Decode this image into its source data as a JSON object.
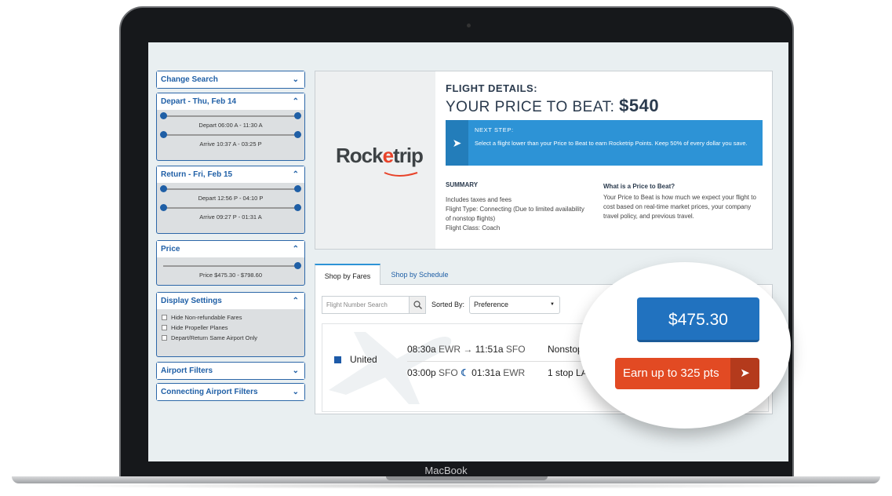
{
  "device": {
    "label": "MacBook"
  },
  "sidebar": {
    "change_search": "Change Search",
    "depart": {
      "title": "Depart - Thu, Feb 14",
      "depart_range": "Depart   06:00 A - 11:30 A",
      "arrive_range": "Arrive   10:37 A - 03:25 P"
    },
    "return": {
      "title": "Return - Fri, Feb 15",
      "depart_range": "Depart   12:56 P - 04:10 P",
      "arrive_range": "Arrive   09:27 P - 01:31 A"
    },
    "price": {
      "title": "Price",
      "range": "Price   $475.30 - $798.60"
    },
    "display": {
      "title": "Display Settings",
      "options": [
        "Hide Non-refundable Fares",
        "Hide Propeller Planes",
        "Depart/Return Same Airport Only"
      ]
    },
    "airport_filters": "Airport Filters",
    "connecting_filters": "Connecting Airport Filters"
  },
  "details": {
    "logo": {
      "part1": "Rock",
      "part2": "e",
      "part3": "trip"
    },
    "title": "FLIGHT DETAILS:",
    "price_label": "YOUR PRICE TO BEAT:",
    "price_value": "$540",
    "next_step_label": "NEXT STEP:",
    "next_step_text": "Select a flight lower than your Price to Beat to earn Rocketrip Points. Keep 50% of every dollar you save.",
    "summary_title": "SUMMARY",
    "summary_lines": [
      "Includes taxes and fees",
      "Flight Type: Connecting (Due to limited availability of nonstop flights)",
      "Flight Class: Coach"
    ],
    "ptb_title": "What is a Price to Beat?",
    "ptb_text": "Your Price to Beat is how much we expect your flight to cost based on real-time market prices, your company travel policy, and previous travel."
  },
  "results": {
    "tabs": [
      "Shop by Fares",
      "Shop by Schedule"
    ],
    "search_placeholder": "Flight Number Search",
    "sorted_by_label": "Sorted By:",
    "sort_value": "Preference",
    "flight": {
      "airline": "United",
      "leg1": {
        "dep_time": "08:30a",
        "dep_airport": "EWR",
        "arrow": "→",
        "arr_time": "11:51a",
        "arr_airport": "SFO",
        "stops": "Nonstop"
      },
      "leg2": {
        "dep_time": "03:00p",
        "dep_airport": "SFO",
        "moon": "☾",
        "arr_time": "01:31a",
        "arr_airport": "EWR",
        "stops": "1 stop LAX"
      },
      "price": "$475.30",
      "earn": "Earn up to 325 pts"
    }
  },
  "colors": {
    "brand_blue": "#2172bf",
    "accent_orange": "#e24a23",
    "link_blue": "#1f5fa6"
  }
}
